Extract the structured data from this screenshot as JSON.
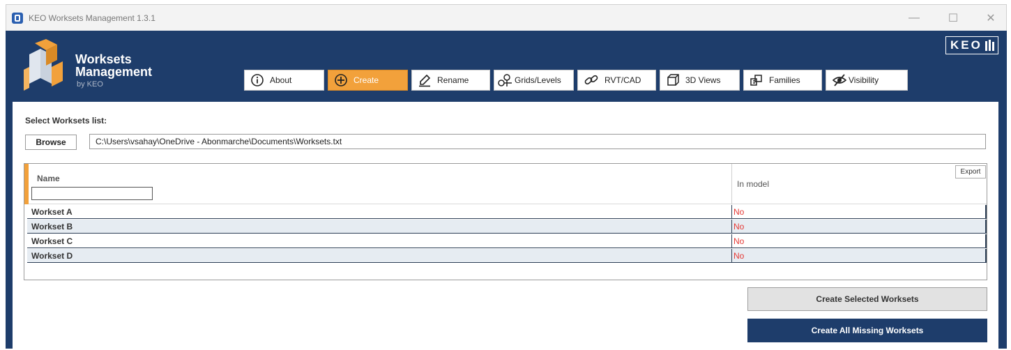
{
  "window": {
    "title": "KEO Worksets Management 1.3.1",
    "minimize_glyph": "—",
    "maximize_glyph": "☐",
    "close_glyph": "✕"
  },
  "brand": {
    "line1": "Worksets",
    "line2": "Management",
    "line3": "by KEO",
    "keo_logo_text": "KEO",
    "logo_colors": [
      "#f2a13b",
      "#e0e6ee"
    ]
  },
  "tabs": [
    {
      "label": "About",
      "icon": "info-icon",
      "active": false
    },
    {
      "label": "Create",
      "icon": "plus-circle-icon",
      "active": true
    },
    {
      "label": "Rename",
      "icon": "pencil-icon",
      "active": false
    },
    {
      "label": "Grids/Levels",
      "icon": "grid-nodes-icon",
      "active": false
    },
    {
      "label": "RVT/CAD",
      "icon": "link-icon",
      "active": false
    },
    {
      "label": "3D Views",
      "icon": "cube-icon",
      "active": false
    },
    {
      "label": "Families",
      "icon": "families-icon",
      "active": false
    },
    {
      "label": "Visibility",
      "icon": "eye-slash-icon",
      "active": false
    }
  ],
  "main": {
    "select_label": "Select Worksets list:",
    "browse_label": "Browse",
    "path_value": "C:\\Users\\vsahay\\OneDrive - Abonmarche\\Documents\\Worksets.txt",
    "grid": {
      "export_label": "Export",
      "columns": [
        "Name",
        "In model"
      ],
      "filter_value": "",
      "rows": [
        {
          "name": "Workset A",
          "in_model": "No"
        },
        {
          "name": "Workset B",
          "in_model": "No"
        },
        {
          "name": "Workset C",
          "in_model": "No"
        },
        {
          "name": "Workset D",
          "in_model": "No"
        }
      ]
    },
    "create_selected_label": "Create Selected Worksets",
    "create_missing_label": "Create All Missing Worksets"
  },
  "colors": {
    "frame_blue": "#1e3d6b",
    "accent_orange": "#f2a13b",
    "status_red": "#e53935"
  }
}
